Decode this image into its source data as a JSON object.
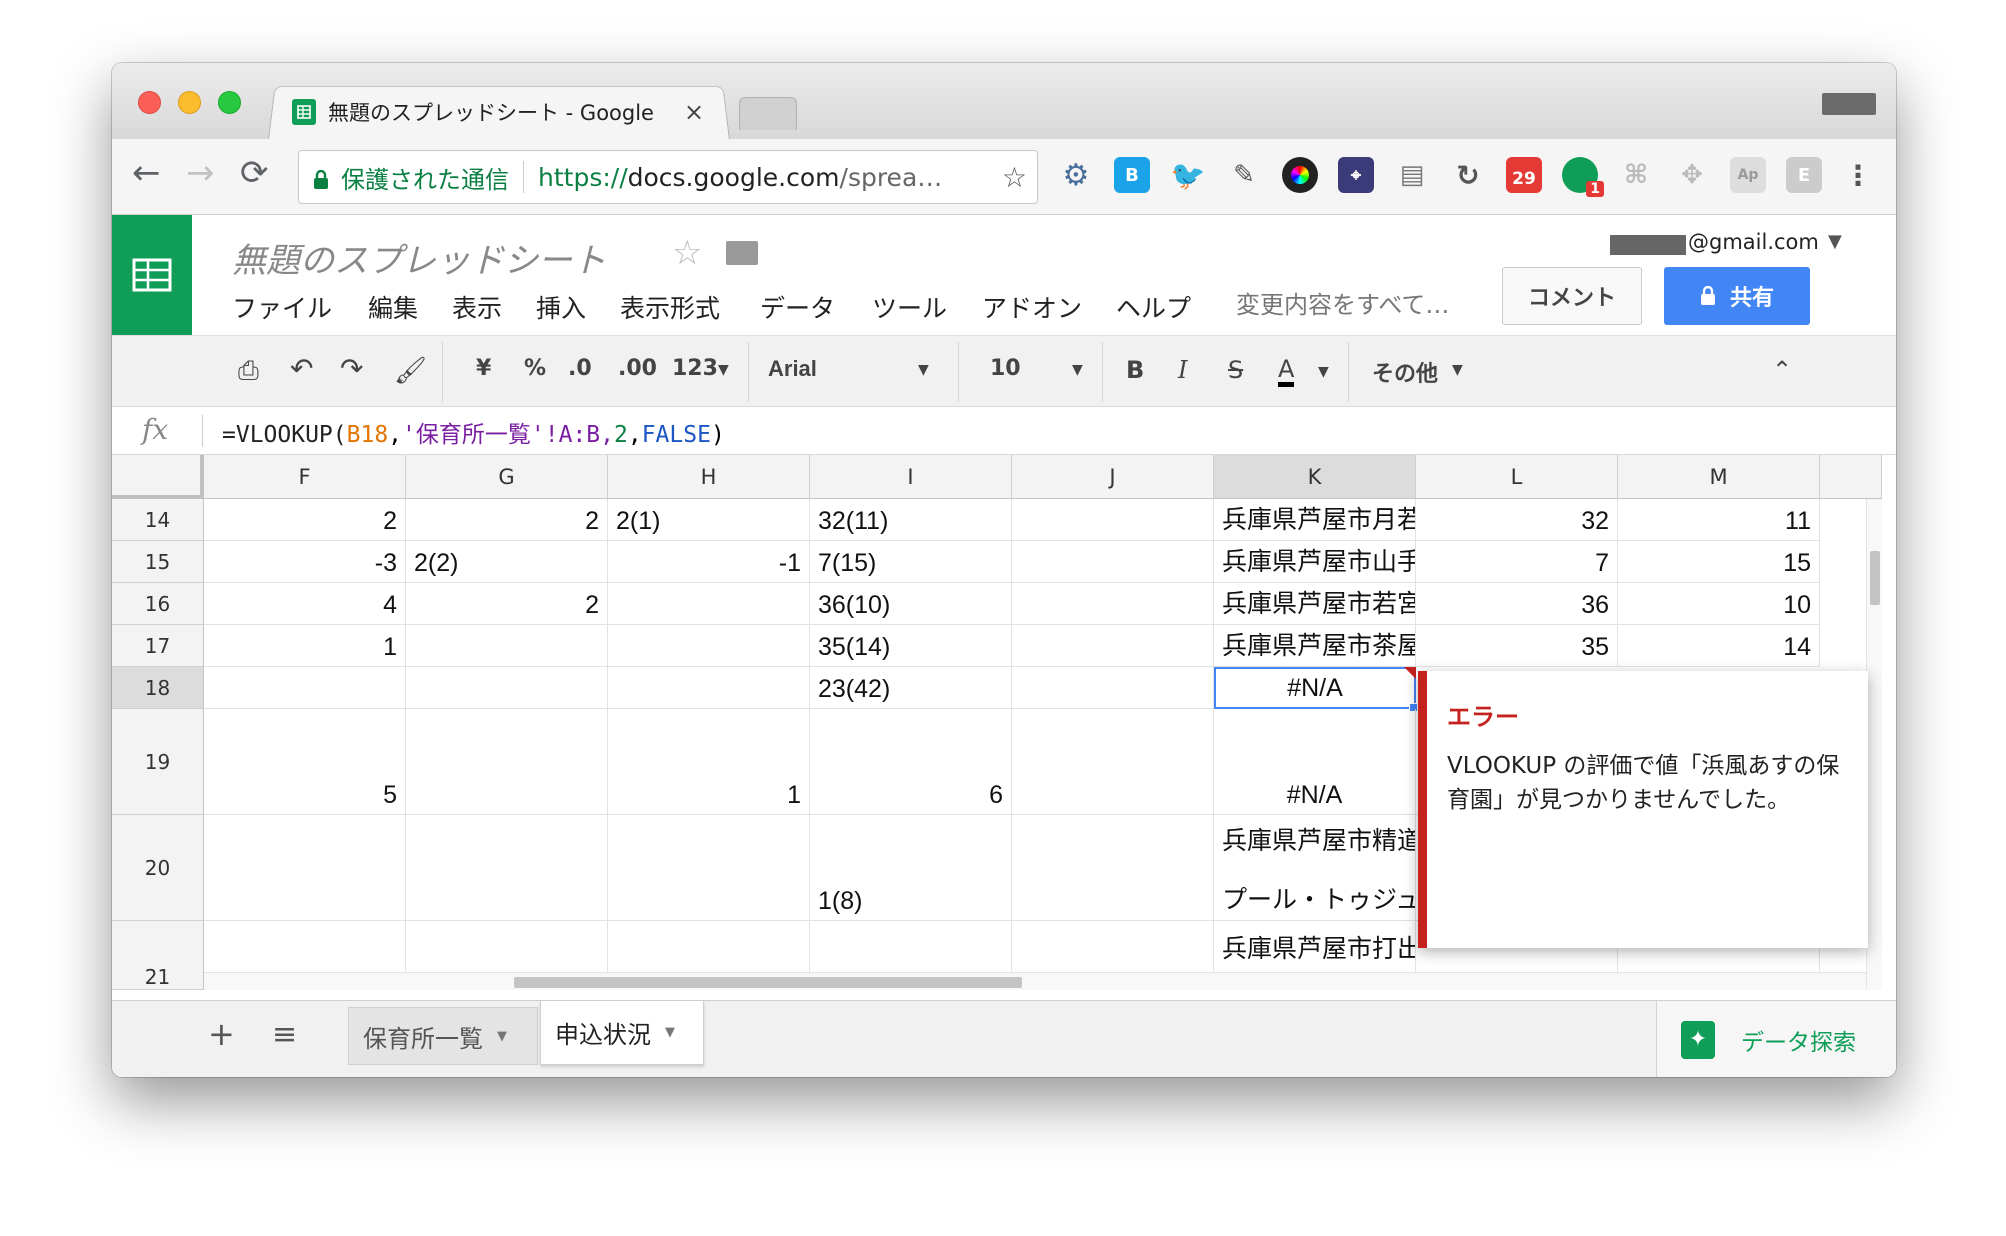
{
  "browser": {
    "tab_title": "無題のスプレッドシート - Google",
    "secure_label": "保護された通信",
    "url_scheme": "https://",
    "url_host": "docs.google.com",
    "url_rest": "/sprea…",
    "ext_badges": {
      "calendar": "29",
      "green": "1"
    }
  },
  "doc": {
    "title": "無題のスプレッドシート",
    "account": "@gmail.com",
    "menus": [
      "ファイル",
      "編集",
      "表示",
      "挿入",
      "表示形式",
      "データ",
      "ツール",
      "アドオン",
      "ヘルプ"
    ],
    "save_status": "変更内容をすべて…",
    "comment_label": "コメント",
    "share_label": "共有"
  },
  "format_toolbar": {
    "currency": "¥",
    "percent": "%",
    "dec_less": ".0",
    "dec_more": ".00",
    "number_format": "123",
    "font": "Arial",
    "size": "10",
    "bold": "B",
    "italic": "I",
    "strike": "S",
    "textcolor": "A",
    "more": "その他"
  },
  "formula_bar": {
    "fx": "fx",
    "eq": "=VLOOKUP(",
    "ref": "B18",
    "comma1": ",",
    "sheet": "'保育所一覧'",
    "range": "!A:B,",
    "idx": "2",
    "comma2": ",",
    "flag": "FALSE",
    "close": ")"
  },
  "grid": {
    "columns": [
      "F",
      "G",
      "H",
      "I",
      "J",
      "K",
      "L",
      "M"
    ],
    "rows": [
      "14",
      "15",
      "16",
      "17",
      "18",
      "19",
      "20",
      "21"
    ],
    "cells": {
      "F14": "2",
      "G14": "2",
      "H14": "2(1)",
      "I14": "32(11)",
      "K14": "兵庫県芦屋市月若",
      "L14": "32",
      "M14": "11",
      "F15": "-3",
      "G15": "2(2)",
      "H15": "-1",
      "I15": "7(15)",
      "K15": "兵庫県芦屋市山手",
      "L15": "7",
      "M15": "15",
      "F16": "4",
      "G16": "2",
      "I16": "36(10)",
      "K16": "兵庫県芦屋市若宮",
      "L16": "36",
      "M16": "10",
      "F17": "1",
      "I17": "35(14)",
      "K17": "兵庫県芦屋市茶屋",
      "L17": "35",
      "M17": "14",
      "I18": "23(42)",
      "K18": "#N/A",
      "F19": "5",
      "H19": "1",
      "I19": "6",
      "K19": "#N/A",
      "K20a": "兵庫県芦屋市精道",
      "I20": "1(8)",
      "K20b": "プール・トゥジュ",
      "K21": "兵庫県芦屋市打出"
    }
  },
  "error_popup": {
    "title": "エラー",
    "message": "VLOOKUP の評価で値「浜風あすの保育園」が見つかりませんでした。"
  },
  "sheet_tabs": {
    "add": "+",
    "tabs": [
      "保育所一覧",
      "申込状況"
    ],
    "explore_label": "データ探索"
  }
}
